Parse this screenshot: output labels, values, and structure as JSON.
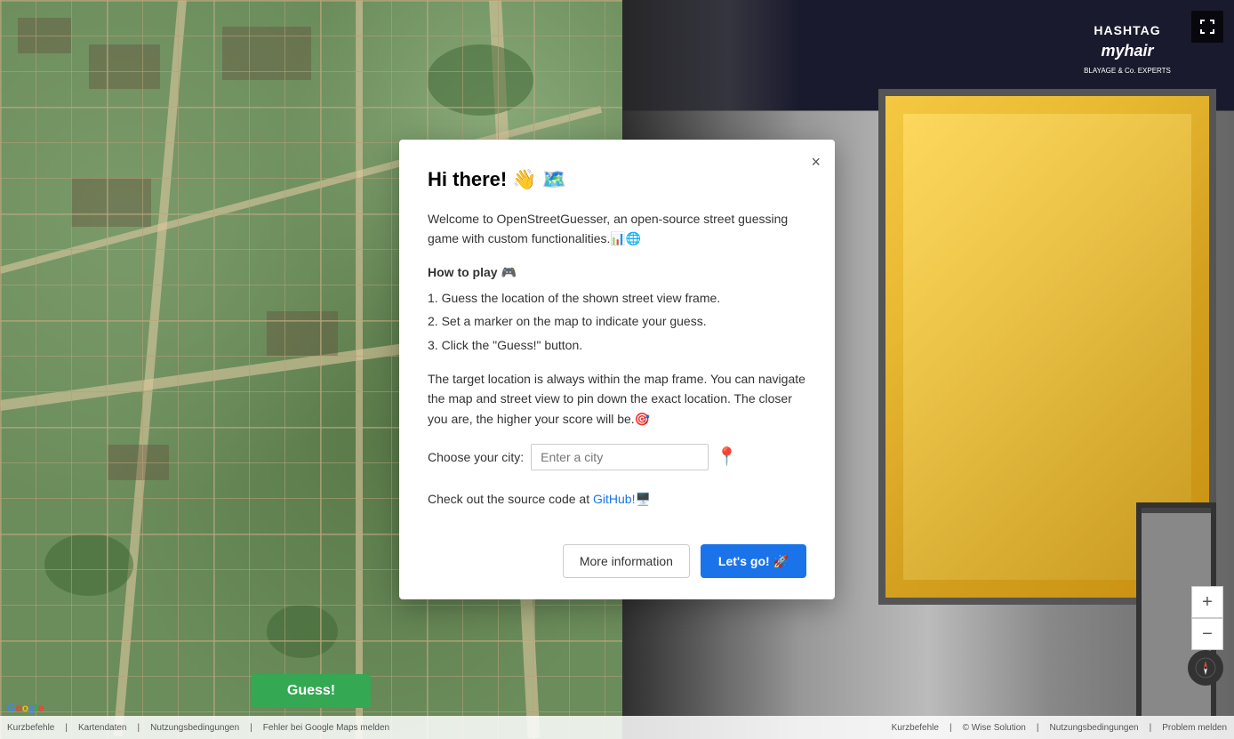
{
  "modal": {
    "title": "Hi there! 👋 🗺️",
    "close_label": "×",
    "welcome_text": "Welcome to OpenStreetGuesser, an open-source street guessing game with custom functionalities.📊🌐",
    "how_to_play_label": "How to play 🎮",
    "steps": [
      "1. Guess the location of the shown street view frame.",
      "2. Set a marker on the map to indicate your guess.",
      "3. Click the \"Guess!\" button."
    ],
    "target_info": "The target location is always within the map frame. You can navigate the map and street view to pin down the exact location. The closer you are, the higher your score will be.🎯",
    "city_label": "Choose your city:",
    "city_placeholder": "Enter a city",
    "github_text": "Check out the source code at ",
    "github_link_text": "GitHub!",
    "github_emoji": "🖥️",
    "more_info_label": "More information",
    "lets_go_label": "Let's go! 🚀"
  },
  "map": {
    "google_logo": "Google",
    "bottom_links": [
      "Kurzbefehle",
      "Kartendaten",
      "Nutzungsbedingungen",
      "Fehler bei Google Maps melden"
    ],
    "separator": "|"
  },
  "street_view": {
    "bottom_links": [
      "Kurzbefehle",
      "© Wise Solution",
      "Nutzungsbedingungen",
      "Problem melden"
    ],
    "shop_sign_line1": "HASHTAG",
    "shop_sign_line2": "myhair",
    "shop_sign_line3": "BLAYAGE & Co. EXPERTS"
  },
  "buttons": {
    "guess_label": "Guess!",
    "fullscreen_icon": "⛶",
    "zoom_in": "+",
    "zoom_out": "−"
  }
}
